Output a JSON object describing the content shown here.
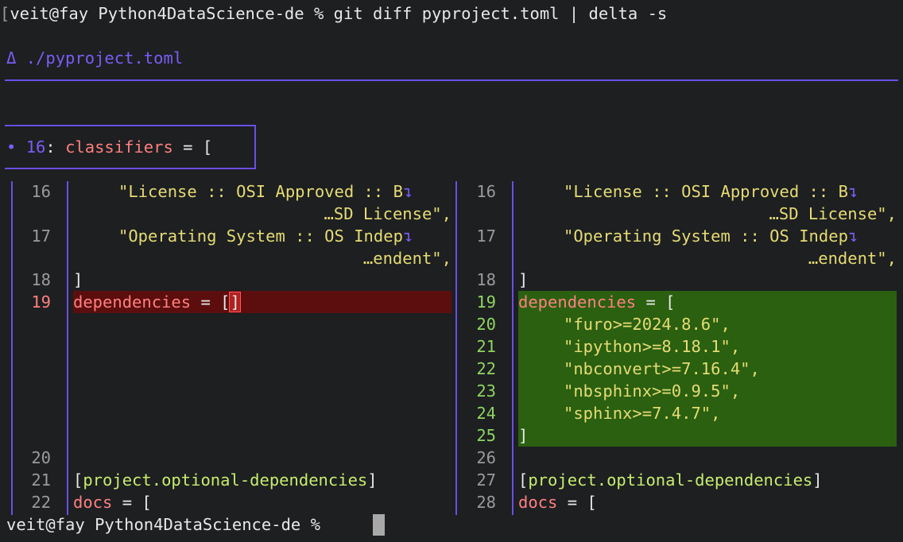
{
  "terminal": {
    "command_prompt": "veit@fay Python4DataScience-de % ",
    "command": "git diff pyproject.toml | delta -s",
    "final_prompt": "veit@fay Python4DataScience-de % "
  },
  "diff": {
    "file_marker": "Δ",
    "file": "./pyproject.toml",
    "hunk": {
      "bullet": "•",
      "line": "16",
      "sep": ": ",
      "name": "classifiers",
      "rest": " = ["
    },
    "left": {
      "rows": [
        {
          "n": "16",
          "text": "\"License :: OSI Approved :: B",
          "cont": "…SD License\","
        },
        {
          "n": "17",
          "text": "\"Operating System :: OS Indep",
          "cont": "…endent\","
        },
        {
          "n": "18",
          "text": "]"
        },
        {
          "n": "19",
          "key": "dependencies",
          "op": " = [",
          "emph": "]"
        },
        {
          "n": "20"
        },
        {
          "n": "21",
          "table": "project.optional-dependencies"
        },
        {
          "n": "22",
          "key": "docs",
          "op": " = ["
        }
      ]
    },
    "right": {
      "rows": [
        {
          "n": "16",
          "text": "\"License :: OSI Approved :: B",
          "cont": "…SD License\","
        },
        {
          "n": "17",
          "text": "\"Operating System :: OS Indep",
          "cont": "…endent\","
        },
        {
          "n": "18",
          "text": "]"
        },
        {
          "n": "19",
          "key": "dependencies",
          "op": " = ["
        },
        {
          "n": "20",
          "dep": "\"furo>=2024.8.6\","
        },
        {
          "n": "21",
          "dep": "\"ipython>=8.18.1\","
        },
        {
          "n": "22",
          "dep": "\"nbconvert>=7.16.4\","
        },
        {
          "n": "23",
          "dep": "\"nbsphinx>=0.9.5\","
        },
        {
          "n": "24",
          "dep": "\"sphinx>=7.4.7\","
        },
        {
          "n": "25",
          "text": "]"
        },
        {
          "n": "26"
        },
        {
          "n": "27",
          "table": "project.optional-dependencies"
        },
        {
          "n": "28",
          "key": "docs",
          "op": " = ["
        }
      ]
    },
    "wrap_marker": "↴"
  },
  "colors": {
    "accent": "#6b4ee6",
    "deleted_bg": "#5c0e0e",
    "added_bg": "#2a6010",
    "keyword": "#ff8080",
    "string": "#e6db74"
  }
}
